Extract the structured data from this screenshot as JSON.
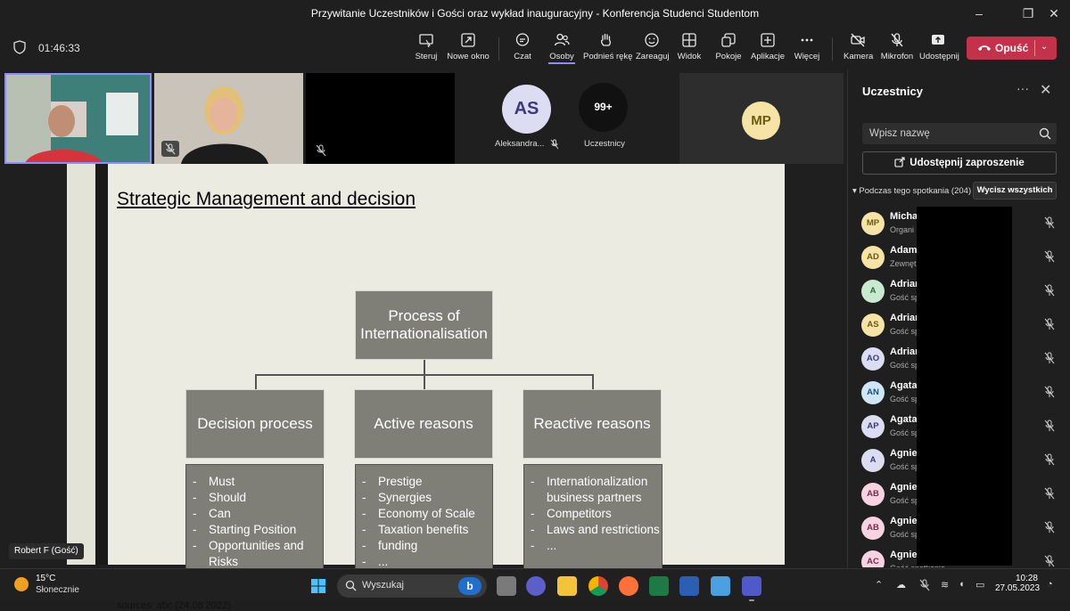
{
  "window": {
    "title": "Przywitanie Uczestników i Gości oraz wykład inauguracyjny - Konferencja Studenci Studentom",
    "controls": [
      "–",
      "❐",
      "✕"
    ]
  },
  "toolbar": {
    "timer": "01:46:33",
    "buttons": [
      {
        "label": "Steruj",
        "icon": "control-icon"
      },
      {
        "label": "Nowe okno",
        "icon": "new-window-icon"
      },
      {
        "label": "Czat",
        "icon": "chat-icon"
      },
      {
        "label": "Osoby",
        "icon": "people-icon",
        "active": true
      },
      {
        "label": "Podnieś rękę",
        "icon": "raise-hand-icon"
      },
      {
        "label": "Zareaguj",
        "icon": "react-icon"
      },
      {
        "label": "Widok",
        "icon": "view-icon"
      },
      {
        "label": "Pokoje",
        "icon": "rooms-icon"
      },
      {
        "label": "Aplikacje",
        "icon": "apps-icon"
      },
      {
        "label": "Więcej",
        "icon": "more-icon"
      },
      {
        "label": "Kamera",
        "icon": "camera-off-icon"
      },
      {
        "label": "Mikrofon",
        "icon": "mic-off-icon"
      },
      {
        "label": "Udostępnij",
        "icon": "share-icon"
      }
    ],
    "leave_label": "Opuść",
    "leave_color": "#c4314b"
  },
  "stage": {
    "tiles": {
      "as_initials": "AS",
      "as_name": "Aleksandra...",
      "overflow_count": "99+",
      "overflow_label": "Uczestnicy",
      "mp_initials": "MP"
    },
    "speaker_caption": "Robert F (Gość)"
  },
  "slide": {
    "title": "Strategic Management and decision",
    "top_box": "Process of Internationalisation",
    "columns": [
      {
        "heading": "Decision process",
        "items": [
          "Must",
          "Should",
          "Can",
          "Starting Position",
          "Opportunities and Risks"
        ]
      },
      {
        "heading": "Active reasons",
        "items": [
          "Prestige",
          "Synergies",
          "Economy of Scale",
          "Taxation benefits",
          "funding",
          "..."
        ]
      },
      {
        "heading": "Reactive reasons",
        "items": [
          "Internationalization business partners",
          "Competitors",
          "Laws and restrictions",
          "..."
        ]
      }
    ],
    "sources": "sources: abc (24.08.2022)"
  },
  "panel": {
    "title": "Uczestnicy",
    "search_placeholder": "Wpisz nazwę",
    "share_invite": "Udostępnij zaproszenie",
    "section_label": "Podczas tego spotkania (204)",
    "kick_all": "Wycisz wszystkich",
    "participants": [
      {
        "initials": "MP",
        "name": "Micha",
        "role": "Organi",
        "color": "#f6e3a6",
        "fg": "#6b5a10"
      },
      {
        "initials": "AD",
        "name": "Adam",
        "role": "Zewnęt",
        "color": "#f6e3a6",
        "fg": "#6b5a10"
      },
      {
        "initials": "A",
        "name": "Adrian",
        "role": "Gość sp",
        "color": "#c9ead0",
        "fg": "#2a6a3a"
      },
      {
        "initials": "AS",
        "name": "Adrian",
        "role": "Gość sp",
        "color": "#f6e3a6",
        "fg": "#6b5a10"
      },
      {
        "initials": "AO",
        "name": "Adrian",
        "role": "Gość sp",
        "color": "#dcdcf2",
        "fg": "#3a3a7a"
      },
      {
        "initials": "AN",
        "name": "Agata",
        "role": "Gość sp",
        "color": "#cfe6f6",
        "fg": "#1f4f7a"
      },
      {
        "initials": "AP",
        "name": "Agata",
        "role": "Gość sp",
        "color": "#dcdcf2",
        "fg": "#3a3a7a"
      },
      {
        "initials": "A",
        "name": "Agnie",
        "role": "Gość sp",
        "color": "#dcdcf2",
        "fg": "#3a3a7a"
      },
      {
        "initials": "AB",
        "name": "Agnie",
        "role": "Gość sp",
        "color": "#f6d3e0",
        "fg": "#7a2a4a"
      },
      {
        "initials": "AB",
        "name": "Agnie",
        "role": "Gość sp",
        "color": "#f6d3e0",
        "fg": "#7a2a4a"
      },
      {
        "initials": "AC",
        "name": "Agnie",
        "role": "Gość spotkania",
        "color": "#f6d3e0",
        "fg": "#7a2a4a"
      }
    ]
  },
  "taskbar": {
    "temp": "15°C",
    "weather": "Słonecznie",
    "search_label": "Wyszukaj",
    "bing_label": "b",
    "time": "10:28",
    "date": "27.05.2023"
  }
}
